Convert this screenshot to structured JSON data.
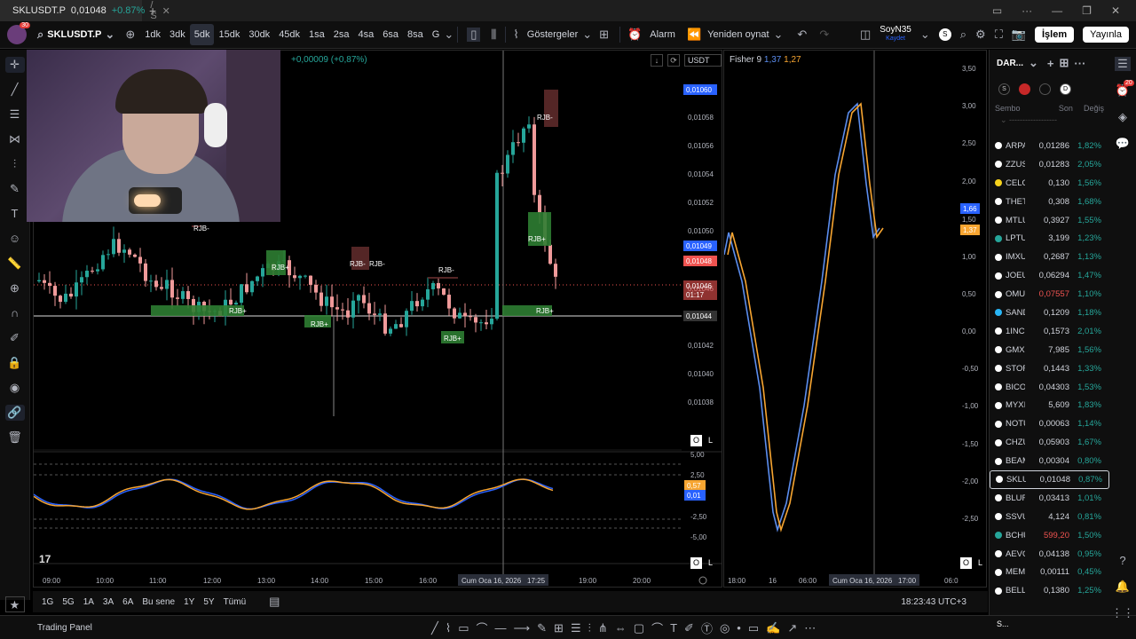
{
  "browser": {
    "tab_title": "SKLUSDT.P",
    "tab_price": "0,01048",
    "tab_change": "+0.87%",
    "tab_suffix": "/ S",
    "new_tab": "+"
  },
  "toolbar": {
    "avatar_badge": "30",
    "symbol": "SKLUSDT.P",
    "intervals": [
      "1dk",
      "3dk",
      "5dk",
      "15dk",
      "30dk",
      "45dk",
      "1sa",
      "2sa",
      "4sa",
      "6sa",
      "8sa",
      "G"
    ],
    "active_interval": "5dk",
    "indicators_label": "Göstergeler",
    "alarm_label": "Alarm",
    "replay_label": "Yeniden oynat",
    "user_name": "SoyN35",
    "user_sub": "Kaydet",
    "user_initial": "S",
    "save_label": "İşlem",
    "publish_label": "Yayınla"
  },
  "main_chart": {
    "change_text": "+0,00009 (+0,87%)",
    "currency": "USDT",
    "price_ticks": [
      "0,01058",
      "0,01056",
      "0,01054",
      "0,01052",
      "0,01050",
      "0,01046",
      "0,01042",
      "0,01040",
      "0,01038"
    ],
    "badge_high": "0,01060",
    "badge_blue": "0,01049",
    "badge_red": "0,01048",
    "badge_countdown_price": "0,01046",
    "badge_countdown_time": "01:17",
    "badge_cursor": "0,01044",
    "osc_ticks": [
      "5,00",
      "2,50",
      "-2,50",
      "-5,00"
    ],
    "osc_badge_orange": "0,57",
    "osc_badge_blue": "0,01",
    "time_ticks": [
      "09:00",
      "10:00",
      "11:00",
      "12:00",
      "13:00",
      "14:00",
      "15:00",
      "16:00",
      "19:00",
      "20:00"
    ],
    "cursor_date": "Cum Oca 16, 2026",
    "cursor_time": "17:25",
    "labels": [
      "RJB-",
      "RJB+",
      "RJB+",
      "RJB+",
      "RJB-",
      "RJB-",
      "RJB-",
      "RJB+",
      "RJB+",
      "RJB-",
      "RJB+"
    ],
    "scale_o": "O",
    "scale_l": "L"
  },
  "fisher": {
    "title": "Fisher 9",
    "v1": "1,37",
    "v2": "1,27",
    "ticks": [
      "3,50",
      "3,00",
      "2,50",
      "2,00",
      "1,50",
      "1,00",
      "0,50",
      "0,00",
      "-0,50",
      "-1,00",
      "-1,50",
      "-2,00",
      "-2,50"
    ],
    "badge_blue": "1,66",
    "badge_orange": "1,37",
    "time_ticks": [
      "18:00",
      "16",
      "06:00",
      "06:0"
    ],
    "cursor_date": "Cum Oca 16, 2026",
    "cursor_time": "17:00",
    "colors": {
      "line1": "#5b8dee",
      "line2": "#f7a531"
    }
  },
  "bottom": {
    "ranges": [
      "1G",
      "5G",
      "1A",
      "3A",
      "6A",
      "Bu sene",
      "1Y",
      "5Y",
      "Tümü"
    ],
    "clock": "18:23:43 UTC+3",
    "trading_panel": "Trading Panel"
  },
  "watchlist": {
    "title": "DAR...",
    "flags": [
      "S",
      "",
      "",
      "D"
    ],
    "col_symbol": "Sembo",
    "col_last": "Son",
    "col_change": "Değiş",
    "rows": [
      {
        "sym": "ARPA",
        "last": "0,01286",
        "chg": "1,82%"
      },
      {
        "sym": "ZZUS",
        "last": "0,01283",
        "chg": "2,05%"
      },
      {
        "sym": "CELO",
        "last": "0,130",
        "chg": "1,56%"
      },
      {
        "sym": "THET",
        "last": "0,308",
        "chg": "1,68%"
      },
      {
        "sym": "MTLU",
        "last": "0,3927",
        "chg": "1,55%"
      },
      {
        "sym": "LPTU",
        "last": "3,199",
        "chg": "1,23%"
      },
      {
        "sym": "IMXU",
        "last": "0,2687",
        "chg": "1,13%"
      },
      {
        "sym": "JOEU",
        "last": "0,06294",
        "chg": "1,47%"
      },
      {
        "sym": "OMU",
        "last": "0,07557",
        "chg": "1,10%",
        "red": true
      },
      {
        "sym": "SAND",
        "last": "0,1209",
        "chg": "1,18%"
      },
      {
        "sym": "1INC",
        "last": "0,1573",
        "chg": "2,01%"
      },
      {
        "sym": "GMX",
        "last": "7,985",
        "chg": "1,56%"
      },
      {
        "sym": "STOR",
        "last": "0,1443",
        "chg": "1,33%"
      },
      {
        "sym": "BICO",
        "last": "0,04303",
        "chg": "1,53%"
      },
      {
        "sym": "MYXI",
        "last": "5,609",
        "chg": "1,83%"
      },
      {
        "sym": "NOTU",
        "last": "0,00063",
        "chg": "1,14%"
      },
      {
        "sym": "CHZU",
        "last": "0,05903",
        "chg": "1,67%"
      },
      {
        "sym": "BEAM",
        "last": "0,00304",
        "chg": "0,80%"
      },
      {
        "sym": "SKLU",
        "last": "0,01048",
        "chg": "0,87%",
        "sel": true
      },
      {
        "sym": "BLUR",
        "last": "0,03413",
        "chg": "1,01%"
      },
      {
        "sym": "SSVU",
        "last": "4,124",
        "chg": "0,81%"
      },
      {
        "sym": "BCHU",
        "last": "599,20",
        "chg": "1,50%",
        "red": true
      },
      {
        "sym": "AEVO",
        "last": "0,04138",
        "chg": "0,95%"
      },
      {
        "sym": "MEM",
        "last": "0,00111",
        "chg": "0,45%"
      },
      {
        "sym": "BELL",
        "last": "0,1380",
        "chg": "1,25%"
      }
    ],
    "bottom_sym": "S...",
    "notif_badge": "20"
  }
}
